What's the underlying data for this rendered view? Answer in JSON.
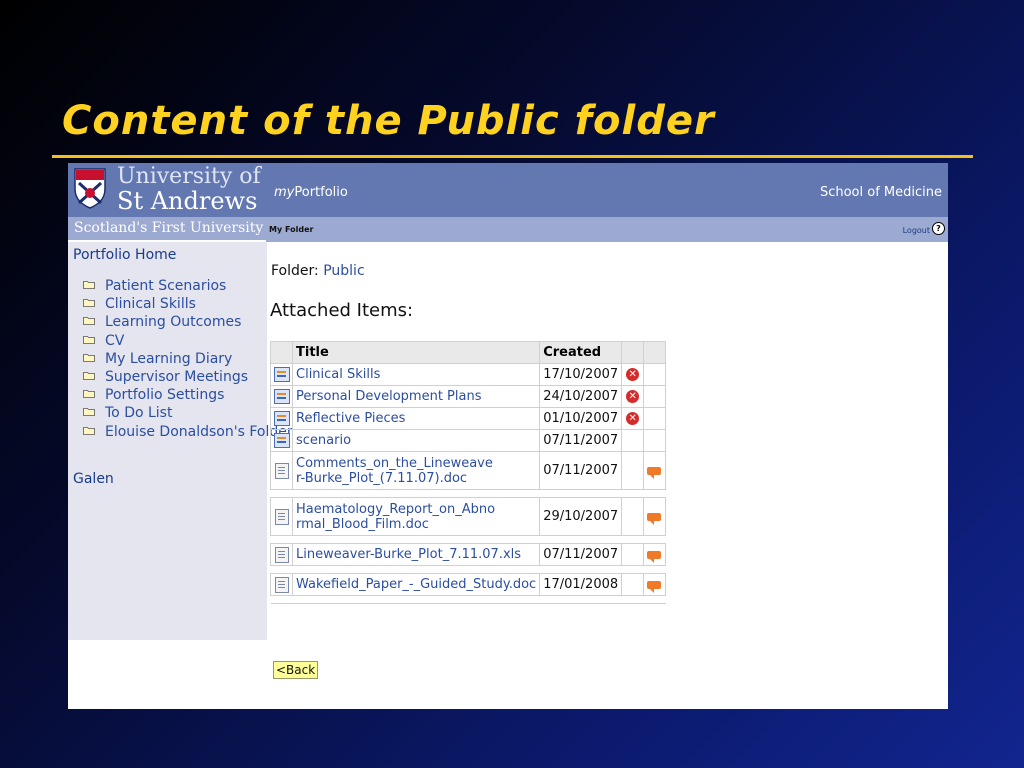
{
  "slide": {
    "title": "Content of the Public folder"
  },
  "header": {
    "university_line1": "University of",
    "university_line2": "St Andrews",
    "tagline": "Scotland's First University",
    "app_name_prefix": "my",
    "app_name_suffix": "Portfolio",
    "school": "School of Medicine"
  },
  "subbar": {
    "current": "My Folder",
    "logout": "Logout",
    "help_icon": "?"
  },
  "sidebar": {
    "home": "Portfolio Home",
    "folders": [
      "Patient Scenarios",
      "Clinical Skills",
      "Learning Outcomes",
      "CV",
      "My Learning Diary",
      "Supervisor Meetings",
      "Portfolio Settings",
      "To Do List",
      "Elouise Donaldson's Folder"
    ],
    "galen": "Galen"
  },
  "main": {
    "folder_label": "Folder:",
    "folder_name": "Public",
    "attached_heading": "Attached Items:",
    "columns": {
      "title": "Title",
      "created": "Created"
    },
    "items": [
      {
        "title": "Clinical Skills",
        "created": "17/10/2007",
        "type": "stack",
        "action": "delete"
      },
      {
        "title": "Personal Development Plans",
        "created": "24/10/2007",
        "type": "stack",
        "action": "delete"
      },
      {
        "title": "Reflective Pieces",
        "created": "01/10/2007",
        "type": "stack",
        "action": "delete"
      },
      {
        "title": "scenario",
        "created": "07/11/2007",
        "type": "stack",
        "action": "none"
      },
      {
        "title": "Comments_on_the_Lineweaver-Burke_Plot_(7.11.07).doc",
        "created": "07/11/2007",
        "type": "doc",
        "action": "comment"
      },
      {
        "title": "Haematology_Report_on_Abnormal_Blood_Film.doc",
        "created": "29/10/2007",
        "type": "doc",
        "action": "comment"
      },
      {
        "title": "Lineweaver-Burke_Plot_7.11.07.xls",
        "created": "07/11/2007",
        "type": "doc",
        "action": "comment"
      },
      {
        "title": "Wakefield_Paper_-_Guided_Study.doc",
        "created": "17/01/2008",
        "type": "doc",
        "action": "comment"
      }
    ],
    "back_button": "<Back"
  },
  "icons": {
    "delete": "delete-icon",
    "comment": "comment-icon",
    "stack": "stack-icon",
    "doc": "document-icon",
    "folder": "folder-icon",
    "crest": "crest-icon"
  },
  "colors": {
    "title_yellow": "#ffd21f",
    "header_blue": "#6378b1",
    "subbar_blue": "#9ca9d1",
    "sidebar_bg": "#e4e5ef",
    "link_blue": "#2c4ea0",
    "delete_red": "#d42b2b",
    "comment_orange": "#f07a2a"
  }
}
